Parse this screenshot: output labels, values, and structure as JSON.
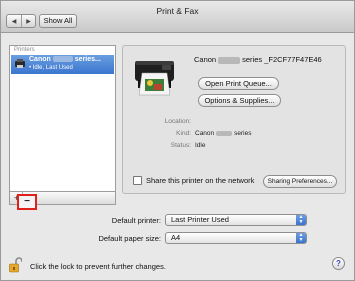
{
  "window": {
    "title": "Print & Fax",
    "nav_back": "◀",
    "nav_forward": "▶",
    "show_all": "Show All"
  },
  "printer_list": {
    "header": "Printers",
    "items": [
      {
        "name_prefix": "Canon",
        "name_suffix": "series...",
        "status": "• Idle, Last Used",
        "selected": true
      }
    ],
    "add_label": "+",
    "remove_label": "−"
  },
  "detail": {
    "name_prefix": "Canon",
    "name_suffix": "series _F2CF77F47E46",
    "open_queue_label": "Open Print Queue...",
    "options_label": "Options & Supplies...",
    "location_label": "Location:",
    "location_value": "",
    "kind_label": "Kind:",
    "kind_prefix": "Canon",
    "kind_suffix": "series",
    "status_label": "Status:",
    "status_value": "Idle",
    "share_label": "Share this printer on the network",
    "share_checked": false,
    "sharing_prefs_label": "Sharing Preferences..."
  },
  "defaults": {
    "printer_label": "Default printer:",
    "printer_value": "Last Printer Used",
    "paper_label": "Default paper size:",
    "paper_value": "A4"
  },
  "footer": {
    "lock_text": "Click the lock to prevent further changes.",
    "help_label": "?"
  },
  "colors": {
    "selection": "#3a75cf",
    "highlight_box": "#e0201b",
    "popup_accent": "#3a74cd"
  },
  "icons": {
    "printer": "printer-icon",
    "lock": "lock-open-icon",
    "help": "help-icon"
  }
}
